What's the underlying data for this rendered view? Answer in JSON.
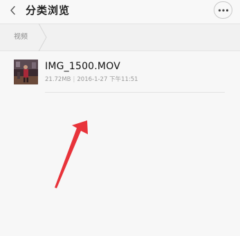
{
  "header": {
    "title": "分类浏览",
    "back_icon": "chevron-left-icon",
    "more_icon": "more-horizontal-icon"
  },
  "breadcrumb": {
    "items": [
      {
        "label": "视频"
      }
    ]
  },
  "files": [
    {
      "name": "IMG_1500.MOV",
      "size": "21.72MB",
      "date": "2016-1-27 下午11:51",
      "thumbnail_icon": "video-thumbnail"
    }
  ],
  "colors": {
    "annotation_arrow": "#e8333a",
    "background": "#f7f7f7"
  }
}
